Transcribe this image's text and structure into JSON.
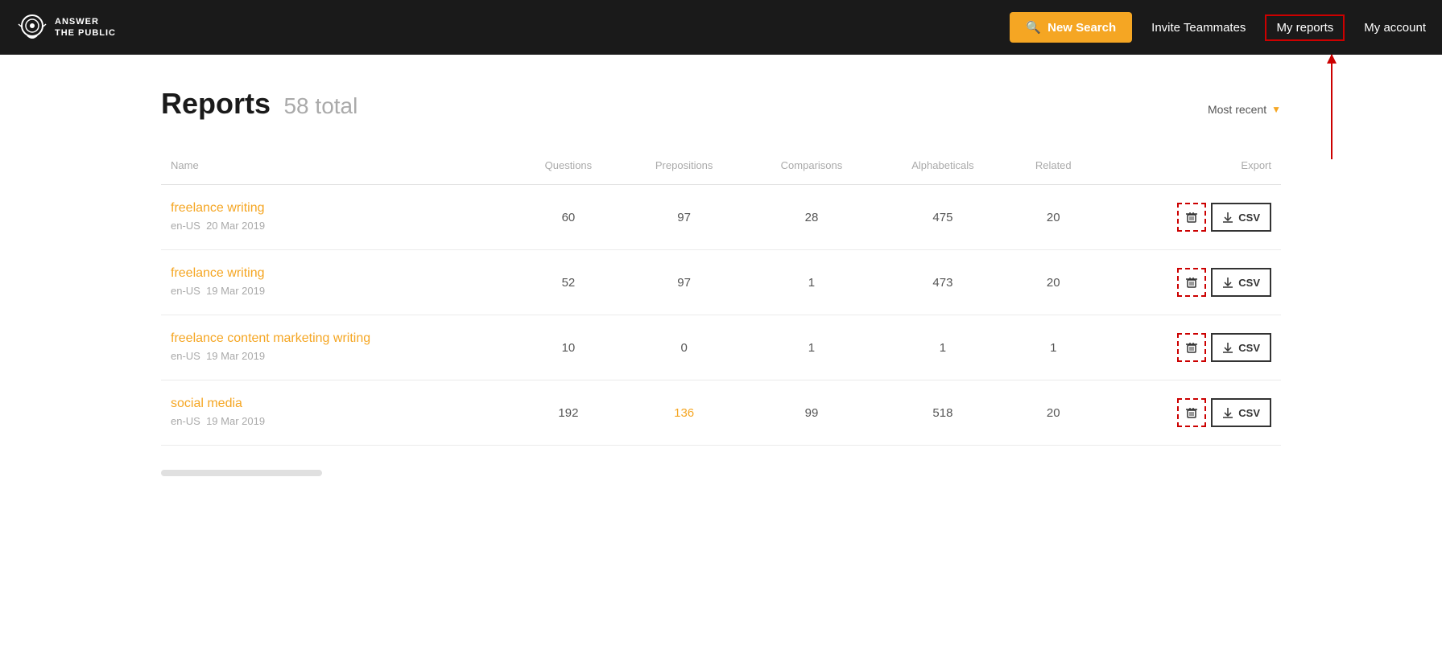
{
  "header": {
    "logo_line1": "ANSWER",
    "logo_line2": "THE PUBLIC",
    "new_search_label": "New Search",
    "invite_teammates_label": "Invite Teammates",
    "my_reports_label": "My reports",
    "my_account_label": "My account"
  },
  "page": {
    "title": "Reports",
    "subtitle": "58 total",
    "sort_label": "Most recent"
  },
  "table": {
    "columns": {
      "name": "Name",
      "questions": "Questions",
      "prepositions": "Prepositions",
      "comparisons": "Comparisons",
      "alphabeticals": "Alphabeticals",
      "related": "Related",
      "export": "Export"
    },
    "rows": [
      {
        "name": "freelance writing",
        "locale": "en-US",
        "date": "20 Mar 2019",
        "questions": "60",
        "prepositions": "97",
        "comparisons": "28",
        "alphabeticals": "475",
        "related": "20",
        "related_orange": false
      },
      {
        "name": "freelance writing",
        "locale": "en-US",
        "date": "19 Mar 2019",
        "questions": "52",
        "prepositions": "97",
        "comparisons": "1",
        "alphabeticals": "473",
        "related": "20",
        "related_orange": false
      },
      {
        "name": "freelance content marketing writing",
        "locale": "en-US",
        "date": "19 Mar 2019",
        "questions": "10",
        "prepositions": "0",
        "comparisons": "1",
        "alphabeticals": "1",
        "related": "1",
        "related_orange": false
      },
      {
        "name": "social media",
        "locale": "en-US",
        "date": "19 Mar 2019",
        "questions": "192",
        "prepositions": "136",
        "comparisons": "99",
        "alphabeticals": "518",
        "related": "20",
        "related_orange": false
      }
    ],
    "delete_label": "🗑",
    "csv_label": "CSV"
  }
}
